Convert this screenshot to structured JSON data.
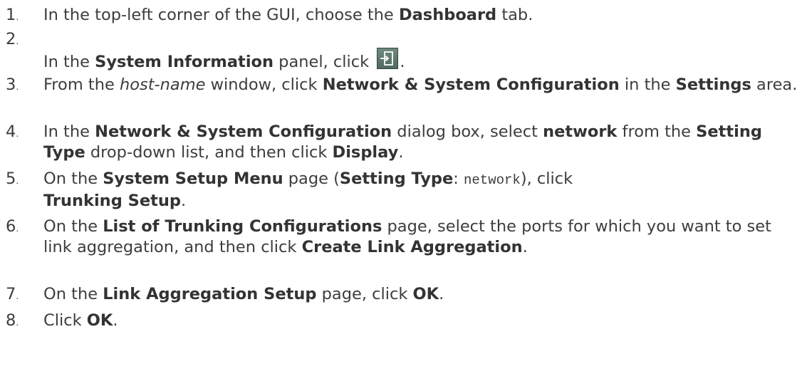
{
  "steps": [
    {
      "num": "1",
      "parts": [
        "In the top-left corner of the GUI, choose the ",
        "Dashboard",
        " tab."
      ]
    },
    {
      "num": "2",
      "parts": [
        "In the ",
        "System Information",
        " panel, click ",
        "."
      ],
      "icon": "enter-icon"
    },
    {
      "num": "3",
      "parts": [
        "From the ",
        "host-name",
        " window, click ",
        "Network & System Configuration",
        " in the ",
        "Settings",
        " area."
      ]
    },
    {
      "num": "4",
      "parts": [
        "In the ",
        "Network & System Configuration",
        " dialog box, select ",
        "network",
        " from the ",
        "Setting Type",
        " drop-down list, and then click ",
        "Display",
        "."
      ]
    },
    {
      "num": "5",
      "parts": [
        "On the ",
        "System Setup Menu",
        " page (",
        "Setting Type",
        ": ",
        "network",
        "), click ",
        "Trunking Setup",
        "."
      ]
    },
    {
      "num": "6",
      "parts": [
        "On the ",
        "List of Trunking Configurations",
        " page, select the ports for which you want to set link aggregation, and then click ",
        "Create Link Aggregation",
        "."
      ]
    },
    {
      "num": "7",
      "parts": [
        "On the ",
        "Link Aggregation Setup",
        " page, click ",
        "OK",
        "."
      ]
    },
    {
      "num": "8",
      "parts": [
        "Click ",
        "OK",
        "."
      ]
    }
  ]
}
